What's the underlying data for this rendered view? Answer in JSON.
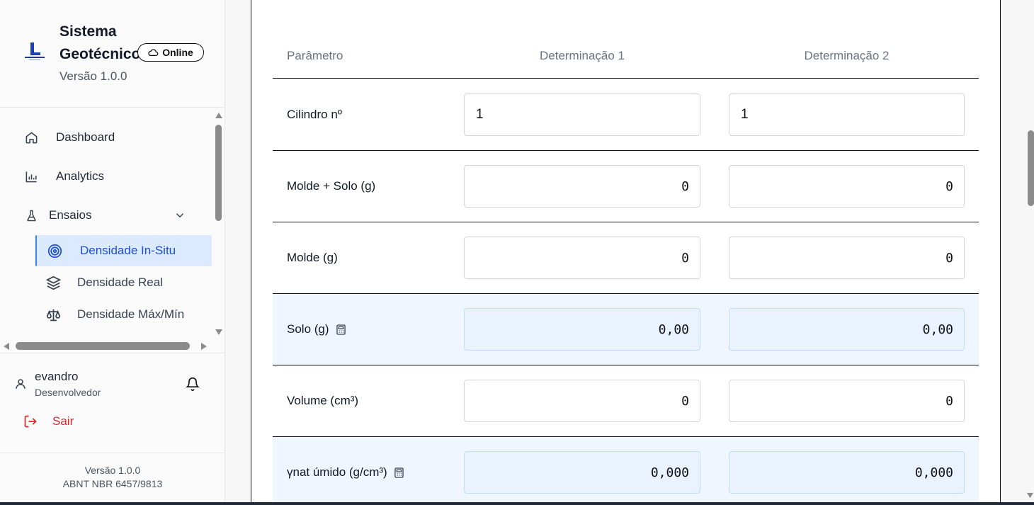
{
  "sidebar": {
    "brand": {
      "title": "Sistema Geotécnico",
      "version": "Versão 1.0.0",
      "status": "Online"
    },
    "nav": [
      {
        "label": "Dashboard",
        "icon": "home-icon"
      },
      {
        "label": "Analytics",
        "icon": "bar-chart-icon"
      },
      {
        "label": "Ensaios",
        "icon": "flask-icon"
      }
    ],
    "sub_items": [
      {
        "label": "Densidade In-Situ",
        "icon": "target-icon",
        "active": true
      },
      {
        "label": "Densidade Real",
        "icon": "layers-icon"
      },
      {
        "label": "Densidade Máx/Mín",
        "icon": "scale-icon"
      }
    ],
    "user": {
      "name": "evandro",
      "role": "Desenvolvedor"
    },
    "logout": "Sair",
    "footer": {
      "version": "Versão 1.0.0",
      "standard": "ABNT NBR 6457/9813"
    }
  },
  "table": {
    "headers": [
      "Parâmetro",
      "Determinação 1",
      "Determinação 2"
    ],
    "rows": [
      {
        "param": "Cilindro nº",
        "d1": "1",
        "d2": "1",
        "calculated": false
      },
      {
        "param": "Molde + Solo (g)",
        "d1": "0",
        "d2": "0",
        "calculated": false
      },
      {
        "param": "Molde (g)",
        "d1": "0",
        "d2": "0",
        "calculated": false
      },
      {
        "param": "Solo (g)",
        "d1": "0,00",
        "d2": "0,00",
        "calculated": true
      },
      {
        "param": "Volume (cm³)",
        "d1": "0",
        "d2": "0",
        "calculated": false
      },
      {
        "param": "γnat úmido (g/cm³)",
        "d1": "0,000",
        "d2": "0,000",
        "calculated": true
      }
    ]
  },
  "colors": {
    "accent": "#1d4ed8",
    "active_bg": "#dbeafe",
    "calc_bg": "#eff6ff",
    "danger": "#dc2626"
  }
}
